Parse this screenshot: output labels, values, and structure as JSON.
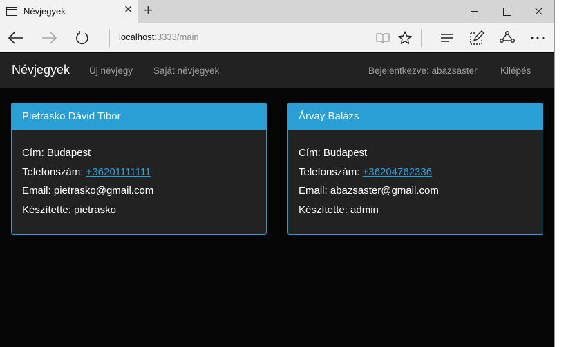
{
  "browser": {
    "tab_title": "Névjegyek",
    "url_host": "localhost",
    "url_rest": ":3333/main"
  },
  "icons": {
    "tab": "page-icon",
    "close_tab": "close-icon",
    "new_tab": "plus-icon",
    "back": "arrow-left-icon",
    "forward": "arrow-right-icon",
    "refresh": "refresh-icon",
    "reading_view": "book-icon",
    "favorite": "star-icon",
    "hub": "hub-icon",
    "web_note": "pen-note-icon",
    "share": "share-icon",
    "more": "more-icon"
  },
  "nav": {
    "brand": "Névjegyek",
    "new_contact": "Új névjegy",
    "own_contacts": "Saját névjegyek",
    "logged_in": "Bejelentkezve: abazsaster",
    "logout": "Kilépés"
  },
  "cards": [
    {
      "name": "Pietrasko Dávid Tibor",
      "address_label": "Cím:",
      "address": "Budapest",
      "phone_label": "Telefonszám:",
      "phone": "+36201111111",
      "email_label": "Email:",
      "email": "pietrasko@gmail.com",
      "creator_label": "Készítette:",
      "creator": "pietrasko"
    },
    {
      "name": "Árvay Balázs",
      "address_label": "Cím:",
      "address": "Budapest",
      "phone_label": "Telefonszám:",
      "phone": "+36204762336",
      "email_label": "Email:",
      "email": "abazsaster@gmail.com",
      "creator_label": "Készítette:",
      "creator": "admin"
    }
  ],
  "colors": {
    "accent": "#2a9fd6",
    "navbar_bg": "#222222",
    "page_bg": "#050505",
    "card_bg": "#222222",
    "nav_text": "#9d9d9d"
  }
}
